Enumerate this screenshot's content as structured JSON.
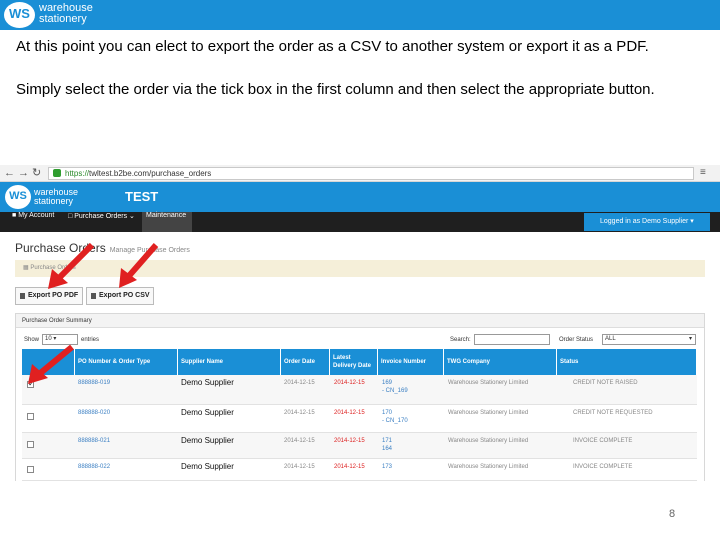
{
  "slide": {
    "brand_initials": "WS",
    "brand_line1": "warehouse",
    "brand_line2": "stationery",
    "instruction_1": "At this point you can elect to export the order as a CSV to another system  or export it as a PDF.",
    "instruction_2": "Simply select the order via the tick box in the first column and then select the appropriate button.",
    "page_number": "8",
    "accent_color": "#1a8fd6",
    "arrow_color": "#e02020"
  },
  "browser": {
    "back_icon": "arrow-left-icon",
    "url_scheme": "https://",
    "url_rest": "twltest.b2be.com/purchase_orders"
  },
  "app": {
    "env_label": "TEST",
    "nav": [
      "My Account",
      "Purchase Orders",
      "Maintenance"
    ],
    "logged_in": "Logged in as Demo Supplier",
    "page_title": "Purchase Orders",
    "page_subtitle": "Manage Purchase Orders",
    "breadcrumb": "Purchase Orders",
    "export_pdf": "Export PO PDF",
    "export_csv": "Export PO CSV",
    "panel_title": "Purchase Order Summary",
    "show_label": "Show",
    "show_value": "10",
    "entries_label": "entries",
    "search_label": "Search:",
    "status_label": "Order Status",
    "status_value": "ALL"
  },
  "table": {
    "headers": [
      "PO Number & Order Type",
      "Supplier Name",
      "Order Date",
      "Latest Delivery Date",
      "Invoice Number",
      "TWG Company",
      "Status"
    ],
    "rows": [
      {
        "checked": true,
        "po": "888888-019",
        "supplier": "Demo Supplier",
        "order_date": "2014-12-15",
        "delivery": "2014-12-15",
        "invoice": "169",
        "invoice_sub": "- CN_169",
        "company": "Warehouse Stationery Limited",
        "status": "CREDIT NOTE RAISED"
      },
      {
        "checked": false,
        "po": "888888-020",
        "supplier": "Demo Supplier",
        "order_date": "2014-12-15",
        "delivery": "2014-12-15",
        "invoice": "170",
        "invoice_sub": "- CN_170",
        "company": "Warehouse Stationery Limited",
        "status": "CREDIT NOTE REQUESTED"
      },
      {
        "checked": false,
        "po": "888888-021",
        "supplier": "Demo Supplier",
        "order_date": "2014-12-15",
        "delivery": "2014-12-15",
        "invoice": "171",
        "invoice_sub": "164",
        "company": "Warehouse Stationery Limited",
        "status": "INVOICE COMPLETE"
      },
      {
        "checked": false,
        "po": "888888-022",
        "supplier": "Demo Supplier",
        "order_date": "2014-12-15",
        "delivery": "2014-12-15",
        "invoice": "173",
        "invoice_sub": "",
        "company": "Warehouse Stationery Limited",
        "status": "INVOICE COMPLETE"
      }
    ]
  }
}
